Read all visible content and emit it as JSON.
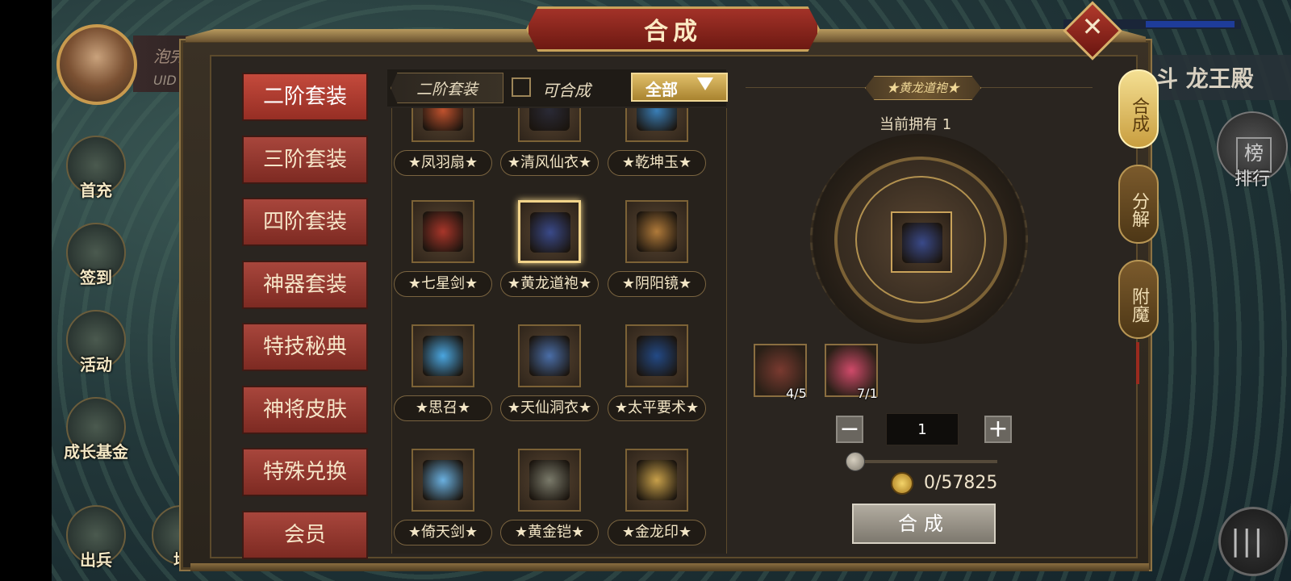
{
  "window": {
    "title": "合成",
    "close_icon": "close-icon"
  },
  "player": {
    "name": "泡完",
    "uid_label": "UID"
  },
  "left_menu": [
    {
      "label": "首充",
      "icon": "gift-icon"
    },
    {
      "label": "签到",
      "icon": "book-icon"
    },
    {
      "label": "活动",
      "icon": "flower-icon"
    },
    {
      "label": "成长基金",
      "icon": "bonsai-icon"
    },
    {
      "label": "出兵",
      "icon": "flag-icon"
    },
    {
      "label": "培",
      "icon": "coin-icon"
    }
  ],
  "right_side": {
    "title": "斗 龙王殿",
    "rank_glyph": "榜",
    "rank_label": "排行",
    "menu_glyph": "|||"
  },
  "categories": [
    {
      "label": "二阶套装",
      "active": true
    },
    {
      "label": "三阶套装",
      "active": false
    },
    {
      "label": "四阶套装",
      "active": false
    },
    {
      "label": "神器套装",
      "active": false
    },
    {
      "label": "特技秘典",
      "active": false
    },
    {
      "label": "神将皮肤",
      "active": false
    },
    {
      "label": "特殊兑换",
      "active": false
    },
    {
      "label": "会员",
      "active": false
    }
  ],
  "filter": {
    "set_name": "二阶套装",
    "checkbox_label": "可合成",
    "checked": false,
    "dropdown_value": "全部"
  },
  "items": [
    {
      "label": "★凤羽扇★",
      "color": "#c0522e"
    },
    {
      "label": "★清风仙衣★",
      "color": "#2a2a36"
    },
    {
      "label": "★乾坤玉★",
      "color": "#3a7fb8"
    },
    {
      "label": "★七星剑★",
      "color": "#a8362a"
    },
    {
      "label": "★黄龙道袍★",
      "color": "#3a4a8a",
      "selected": true
    },
    {
      "label": "★阴阳镜★",
      "color": "#b07a3a"
    },
    {
      "label": "★思召★",
      "color": "#4aa6e0"
    },
    {
      "label": "★天仙洞衣★",
      "color": "#4a6ea8"
    },
    {
      "label": "★太平要术★",
      "color": "#234a86"
    },
    {
      "label": "★倚天剑★",
      "color": "#6ab0e0"
    },
    {
      "label": "★黄金铠★",
      "color": "#7a7a6a"
    },
    {
      "label": "★金龙印★",
      "color": "#c8a04a"
    }
  ],
  "detail": {
    "item_name": "★黄龙道袍★",
    "owned_label": "当前拥有 1",
    "materials": [
      {
        "count": "4/5",
        "icon": "demon-mask-icon",
        "color": "#7a3a30"
      },
      {
        "count": "7/1",
        "icon": "red-gem-icon",
        "color": "#d04a6a"
      }
    ],
    "quantity": "1",
    "minus": "−",
    "plus": "+",
    "slider_fraction": 0,
    "cost": "0/57825",
    "compose_label": "合成"
  },
  "tabs": [
    {
      "label": "合成",
      "active": true
    },
    {
      "label": "分解",
      "active": false
    },
    {
      "label": "附魔",
      "active": false
    }
  ]
}
